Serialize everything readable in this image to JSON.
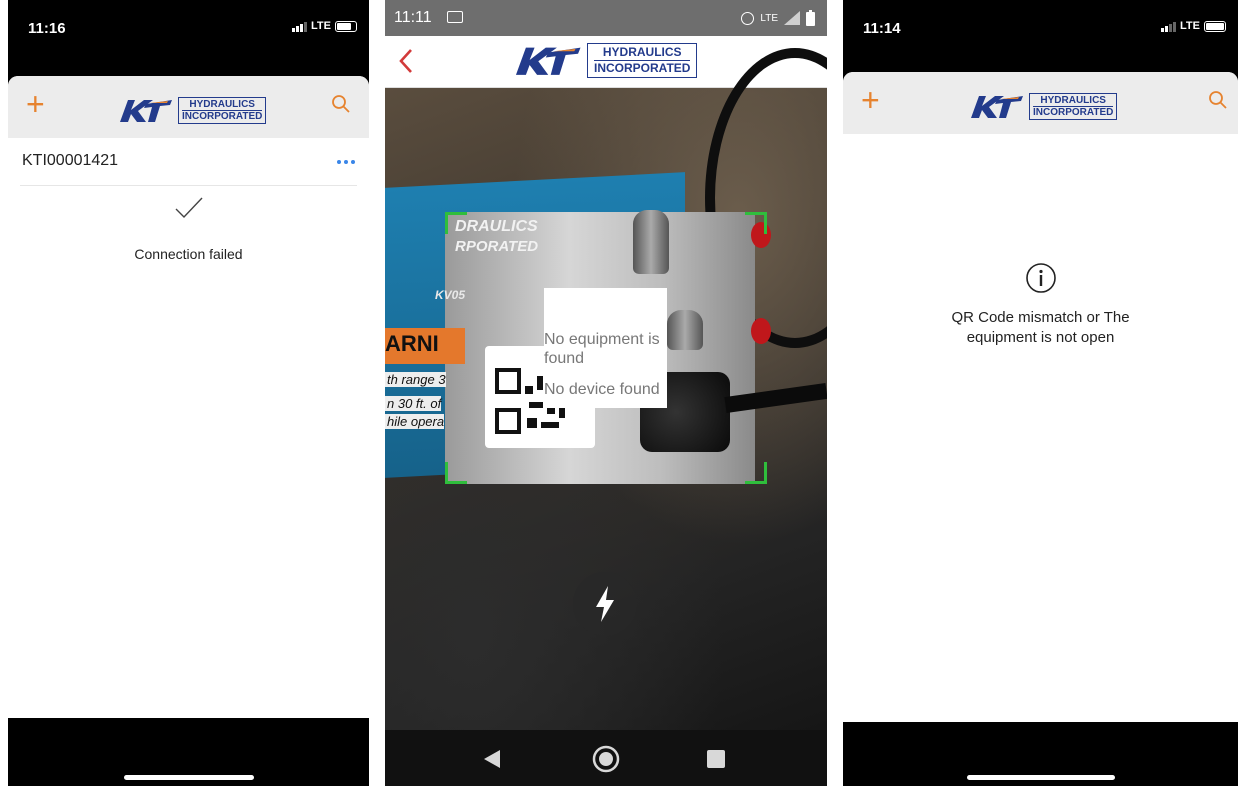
{
  "brand": {
    "line1": "HYDRAULICS",
    "line2": "INCORPORATED",
    "accent_color": "#e6832f",
    "logo_color": "#233b8c"
  },
  "screen1": {
    "status": {
      "time": "11:16",
      "network": "LTE"
    },
    "list_item": "KTI00001421",
    "message": "Connection failed",
    "icons": [
      "plus-icon",
      "search-icon",
      "more-icon",
      "checkmark-icon"
    ]
  },
  "screen2": {
    "status": {
      "time": "11:11",
      "network": "LTE"
    },
    "camera_labels": {
      "top": "DRAULICS",
      "mid": "RPORATED",
      "model": "KV05",
      "warning": "ARNI",
      "line1": "th range 3",
      "line2": "n 30 ft. of",
      "line3": "hile opera"
    },
    "popup": {
      "line1": "No equipment is found",
      "line2": "No device found"
    },
    "icons": [
      "back-icon",
      "flash-icon",
      "nav-back-icon",
      "nav-home-icon",
      "nav-recents-icon"
    ]
  },
  "screen3": {
    "status": {
      "time": "11:14",
      "network": "LTE"
    },
    "message": "QR Code mismatch or The equipment is not open",
    "icons": [
      "plus-icon",
      "search-icon",
      "info-icon"
    ]
  }
}
